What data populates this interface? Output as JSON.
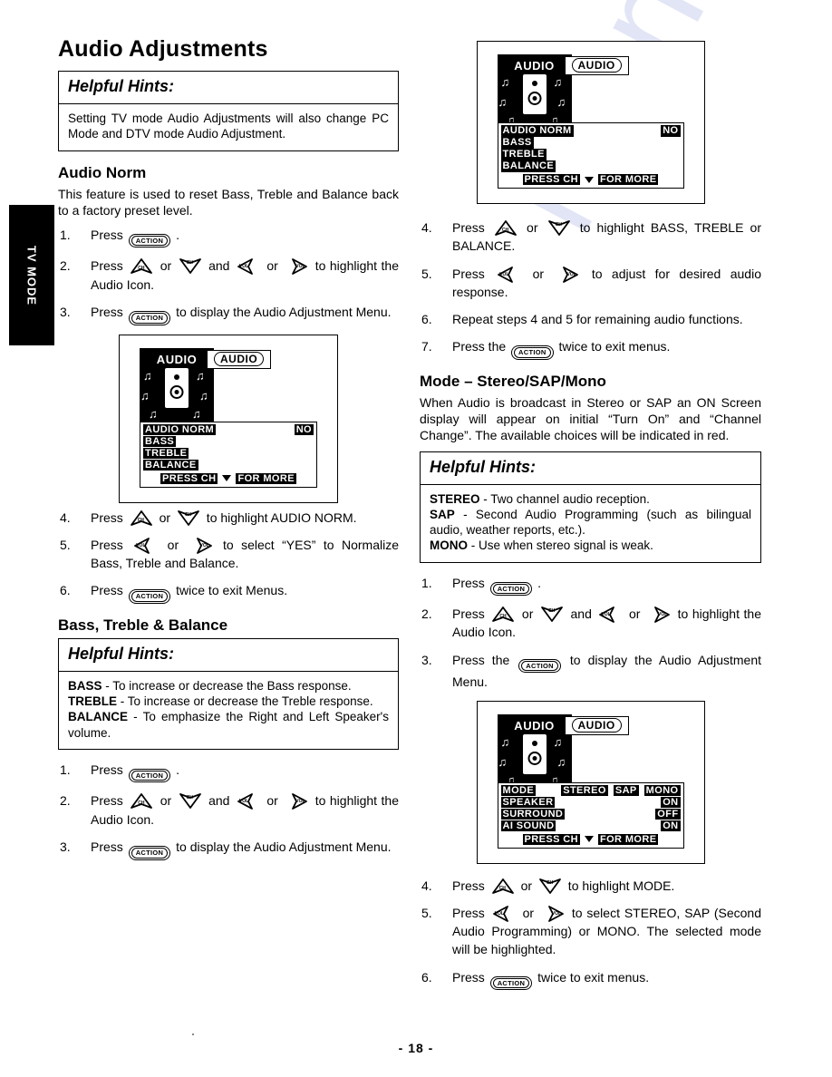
{
  "document": {
    "page_number": "- 18 -",
    "side_tab_label": "TV MODE",
    "watermark": "manualslib"
  },
  "left_column": {
    "title": "Audio Adjustments",
    "hints": {
      "heading": "Helpful Hints:",
      "body": "Setting TV mode Audio Adjustments will also change PC Mode and DTV mode Audio Adjustment."
    },
    "audio_norm": {
      "title": "Audio Norm",
      "intro": "This feature is used to reset Bass, Treble and Balance back to a factory preset level.",
      "steps_before": [
        {
          "num": "1.",
          "parts": [
            {
              "t": "text",
              "v": "Press "
            },
            {
              "t": "action",
              "v": "ACTION"
            },
            {
              "t": "text",
              "v": " ."
            }
          ]
        },
        {
          "num": "2.",
          "parts": [
            {
              "t": "text",
              "v": "Press "
            },
            {
              "t": "arrow",
              "dir": "up",
              "label": "CH"
            },
            {
              "t": "text",
              "v": " or "
            },
            {
              "t": "arrow",
              "dir": "down",
              "label": "CH"
            },
            {
              "t": "text",
              "v": " and "
            },
            {
              "t": "arrow",
              "dir": "left",
              "label": "VOL"
            },
            {
              "t": "text",
              "v": " or "
            },
            {
              "t": "arrow",
              "dir": "right",
              "label": "VOL"
            },
            {
              "t": "text",
              "v": " to highlight the Audio Icon."
            }
          ]
        },
        {
          "num": "3.",
          "parts": [
            {
              "t": "text",
              "v": "Press "
            },
            {
              "t": "action",
              "v": "ACTION"
            },
            {
              "t": "text",
              "v": " to display the Audio Adjustment Menu."
            }
          ]
        }
      ],
      "steps_after": [
        {
          "num": "4.",
          "parts": [
            {
              "t": "text",
              "v": "Press "
            },
            {
              "t": "arrow",
              "dir": "up",
              "label": "CH"
            },
            {
              "t": "text",
              "v": " or "
            },
            {
              "t": "arrow",
              "dir": "down",
              "label": "CH"
            },
            {
              "t": "text",
              "v": " to highlight AUDIO NORM."
            }
          ]
        },
        {
          "num": "5.",
          "parts": [
            {
              "t": "text",
              "v": "Press "
            },
            {
              "t": "arrow",
              "dir": "left",
              "label": "VOL"
            },
            {
              "t": "text",
              "v": " or "
            },
            {
              "t": "arrow",
              "dir": "right",
              "label": "VOL"
            },
            {
              "t": "text",
              "v": " to select “YES” to Normalize Bass, Treble and Balance."
            }
          ]
        },
        {
          "num": "6.",
          "parts": [
            {
              "t": "text",
              "v": "Press "
            },
            {
              "t": "action",
              "v": "ACTION"
            },
            {
              "t": "text",
              "v": " twice to exit Menus."
            }
          ]
        }
      ]
    },
    "bass_treble_balance": {
      "title": "Bass, Treble & Balance",
      "hints": {
        "heading": "Helpful Hints:",
        "lines": [
          {
            "term": "BASS",
            "sep": " - ",
            "desc": "To increase or decrease the Bass response."
          },
          {
            "term": "TREBLE",
            "sep": " - ",
            "desc": "To increase or decrease the Treble response."
          },
          {
            "term": "BALANCE",
            "sep": " - ",
            "desc": "To emphasize the Right and Left Speaker's volume."
          }
        ]
      },
      "steps": [
        {
          "num": "1.",
          "parts": [
            {
              "t": "text",
              "v": "Press "
            },
            {
              "t": "action",
              "v": "ACTION"
            },
            {
              "t": "text",
              "v": " ."
            }
          ]
        },
        {
          "num": "2.",
          "parts": [
            {
              "t": "text",
              "v": "Press "
            },
            {
              "t": "arrow",
              "dir": "up",
              "label": "CH"
            },
            {
              "t": "text",
              "v": " or "
            },
            {
              "t": "arrow",
              "dir": "down",
              "label": "CH"
            },
            {
              "t": "text",
              "v": " and "
            },
            {
              "t": "arrow",
              "dir": "left",
              "label": "VOL"
            },
            {
              "t": "text",
              "v": " or "
            },
            {
              "t": "arrow",
              "dir": "right",
              "label": "VOL"
            },
            {
              "t": "text",
              "v": " to highlight the Audio Icon."
            }
          ]
        },
        {
          "num": "3.",
          "parts": [
            {
              "t": "text",
              "v": "Press "
            },
            {
              "t": "action",
              "v": "ACTION"
            },
            {
              "t": "text",
              "v": " to display the Audio Adjustment Menu."
            }
          ]
        }
      ]
    }
  },
  "right_column": {
    "steps_after_top_figure": [
      {
        "num": "4.",
        "parts": [
          {
            "t": "text",
            "v": "Press "
          },
          {
            "t": "arrow",
            "dir": "up",
            "label": "CH"
          },
          {
            "t": "text",
            "v": " or "
          },
          {
            "t": "arrow",
            "dir": "down",
            "label": "CH"
          },
          {
            "t": "text",
            "v": " to highlight BASS, TREBLE or BALANCE."
          }
        ]
      },
      {
        "num": "5.",
        "parts": [
          {
            "t": "text",
            "v": "Press "
          },
          {
            "t": "arrow",
            "dir": "left",
            "label": "VOL"
          },
          {
            "t": "text",
            "v": " or "
          },
          {
            "t": "arrow",
            "dir": "right",
            "label": "VOL"
          },
          {
            "t": "text",
            "v": " to adjust for desired audio response."
          }
        ]
      },
      {
        "num": "6.",
        "parts": [
          {
            "t": "text",
            "v": "Repeat steps 4 and 5 for remaining audio functions."
          }
        ]
      },
      {
        "num": "7.",
        "parts": [
          {
            "t": "text",
            "v": "Press the "
          },
          {
            "t": "action",
            "v": "ACTION"
          },
          {
            "t": "text",
            "v": " twice to exit menus."
          }
        ]
      }
    ],
    "mode_section": {
      "title": "Mode – Stereo/SAP/Mono",
      "intro": "When Audio is broadcast in Stereo or SAP an ON Screen display will appear on initial “Turn On” and “Channel Change”. The available choices will be indicated in red.",
      "hints": {
        "heading": "Helpful Hints:",
        "lines": [
          {
            "term": "STEREO",
            "sep": " - ",
            "desc": "Two channel audio reception."
          },
          {
            "term": "SAP",
            "sep": " - ",
            "desc": "Second Audio Programming (such as bilingual audio, weather reports, etc.)."
          },
          {
            "term": "MONO",
            "sep": " - ",
            "desc": "Use when stereo signal is weak."
          }
        ]
      },
      "steps_before": [
        {
          "num": "1.",
          "parts": [
            {
              "t": "text",
              "v": "Press "
            },
            {
              "t": "action",
              "v": "ACTION"
            },
            {
              "t": "text",
              "v": " ."
            }
          ]
        },
        {
          "num": "2.",
          "parts": [
            {
              "t": "text",
              "v": "Press "
            },
            {
              "t": "arrow",
              "dir": "up",
              "label": "CH"
            },
            {
              "t": "text",
              "v": " or "
            },
            {
              "t": "arrow",
              "dir": "down",
              "label": "CH"
            },
            {
              "t": "text",
              "v": " and "
            },
            {
              "t": "arrow",
              "dir": "left",
              "label": "VOL"
            },
            {
              "t": "text",
              "v": " or "
            },
            {
              "t": "arrow",
              "dir": "right",
              "label": "VOL"
            },
            {
              "t": "text",
              "v": " to highlight the Audio Icon."
            }
          ]
        },
        {
          "num": "3.",
          "parts": [
            {
              "t": "text",
              "v": "Press the "
            },
            {
              "t": "action",
              "v": "ACTION"
            },
            {
              "t": "text",
              "v": " to display the Audio Adjustment Menu."
            }
          ]
        }
      ],
      "steps_after": [
        {
          "num": "4.",
          "parts": [
            {
              "t": "text",
              "v": "Press "
            },
            {
              "t": "arrow",
              "dir": "up",
              "label": "CH"
            },
            {
              "t": "text",
              "v": " or "
            },
            {
              "t": "arrow",
              "dir": "down",
              "label": "CH"
            },
            {
              "t": "text",
              "v": " to highlight MODE."
            }
          ]
        },
        {
          "num": "5.",
          "parts": [
            {
              "t": "text",
              "v": "Press "
            },
            {
              "t": "arrow",
              "dir": "left",
              "label": "VOL"
            },
            {
              "t": "text",
              "v": " or "
            },
            {
              "t": "arrow",
              "dir": "right",
              "label": "VOL"
            },
            {
              "t": "text",
              "v": " to select STEREO, SAP (Second Audio Programming) or MONO. The selected mode will be highlighted."
            }
          ]
        },
        {
          "num": "6.",
          "parts": [
            {
              "t": "text",
              "v": "Press "
            },
            {
              "t": "action",
              "v": "ACTION"
            },
            {
              "t": "text",
              "v": " twice to exit menus."
            }
          ]
        }
      ]
    }
  },
  "figures": {
    "audio_norm_menu": {
      "icon_label": "AUDIO",
      "badge_label": "AUDIO",
      "rows": [
        {
          "label": "AUDIO NORM",
          "label_state": "inverted",
          "value": "NO",
          "value_state": "inverted"
        },
        {
          "label": "BASS",
          "label_state": "inverted",
          "value": "",
          "value_state": "plain"
        },
        {
          "label": "TREBLE",
          "label_state": "inverted",
          "value": "",
          "value_state": "plain"
        },
        {
          "label": "BALANCE",
          "label_state": "inverted",
          "value": "",
          "value_state": "plain"
        }
      ],
      "footer_left": "PRESS CH",
      "footer_right": "FOR MORE"
    },
    "bass_treble_menu": {
      "icon_label": "AUDIO",
      "badge_label": "AUDIO",
      "rows": [
        {
          "label": "AUDIO NORM",
          "label_state": "inverted",
          "value": "NO",
          "value_state": "inverted"
        },
        {
          "label": "BASS",
          "label_state": "inverted",
          "value": "",
          "value_state": "plain"
        },
        {
          "label": "TREBLE",
          "label_state": "inverted",
          "value": "",
          "value_state": "plain"
        },
        {
          "label": "BALANCE",
          "label_state": "inverted",
          "value": "",
          "value_state": "plain"
        }
      ],
      "footer_left": "PRESS CH",
      "footer_right": "FOR MORE"
    },
    "mode_menu": {
      "icon_label": "AUDIO",
      "badge_label": "AUDIO",
      "rows": [
        {
          "label": "MODE",
          "label_state": "inverted",
          "cells": [
            {
              "text": "STEREO",
              "state": "inverted"
            },
            {
              "text": "SAP",
              "state": "inverted"
            },
            {
              "text": "MONO",
              "state": "inverted"
            }
          ]
        },
        {
          "label": "SPEAKER",
          "label_state": "inverted",
          "value": "ON",
          "value_state": "inverted"
        },
        {
          "label": "SURROUND",
          "label_state": "inverted",
          "value": "OFF",
          "value_state": "inverted"
        },
        {
          "label": "AI SOUND",
          "label_state": "inverted",
          "value": "ON",
          "value_state": "inverted"
        }
      ],
      "footer_left": "PRESS CH",
      "footer_right": "FOR MORE"
    }
  }
}
